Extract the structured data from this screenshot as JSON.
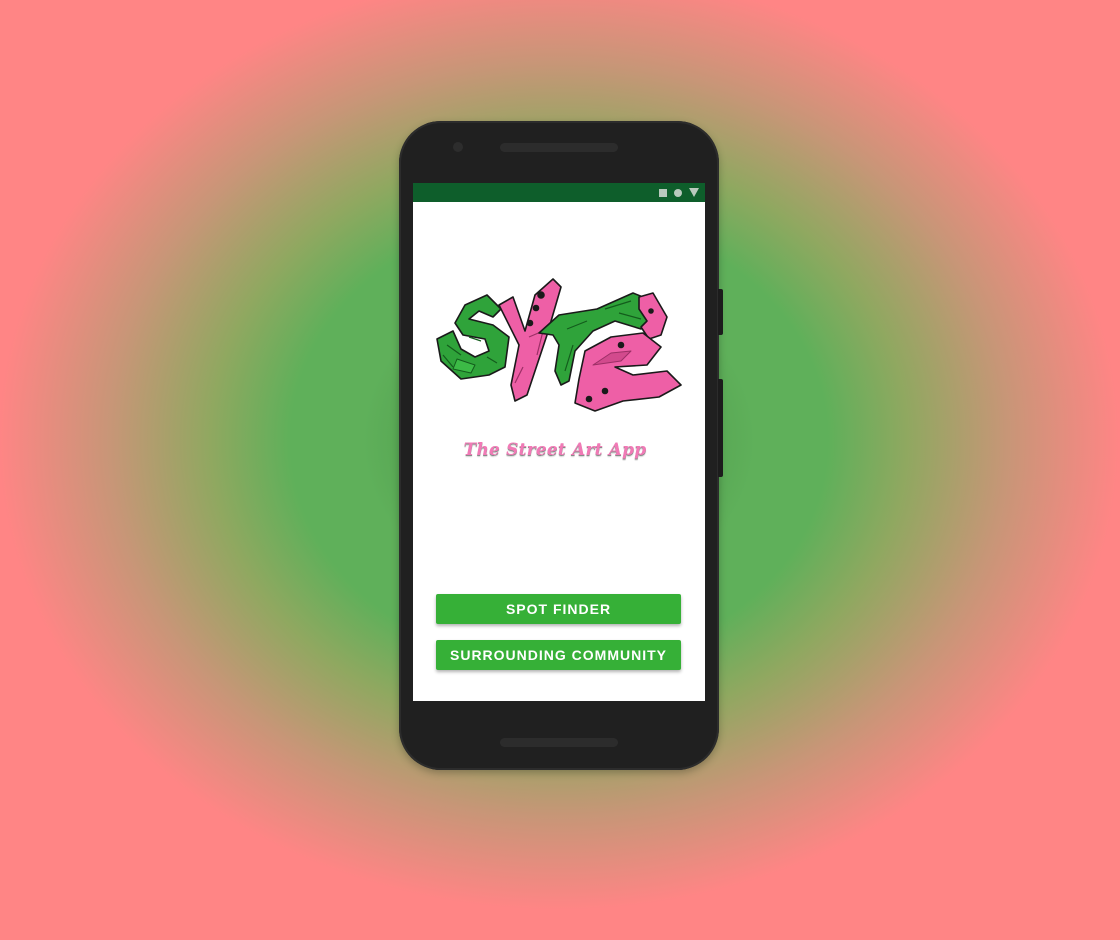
{
  "app": {
    "logo_text": "SYTE",
    "tagline": "The Street Art App"
  },
  "status_bar": {
    "icons": [
      "stop-square-icon",
      "home-circle-icon",
      "back-triangle-icon"
    ]
  },
  "buttons": {
    "spot_finder": "SPOT FINDER",
    "surrounding_community": "SURROUNDING COMMUNITY"
  },
  "colors": {
    "status_bar": "#0e5e2b",
    "button": "#36b037",
    "logo_green": "#2fa33a",
    "logo_pink": "#ee5fa6",
    "tagline": "#f17ab6"
  }
}
